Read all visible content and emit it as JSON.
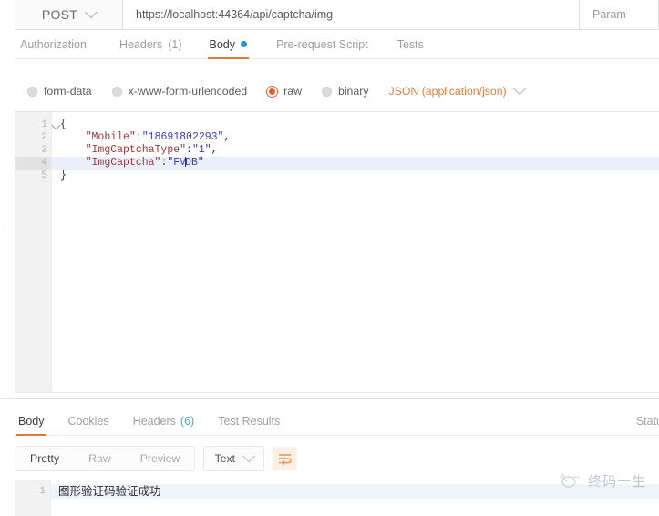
{
  "request": {
    "method": "POST",
    "url": "https://localhost:44364/api/captcha/img",
    "params_label": "Param",
    "tabs": [
      {
        "label": "Authorization",
        "count": "",
        "dot": false,
        "active": false
      },
      {
        "label": "Headers",
        "count": "(1)",
        "dot": false,
        "active": false
      },
      {
        "label": "Body",
        "count": "",
        "dot": true,
        "active": true
      },
      {
        "label": "Pre-request Script",
        "count": "",
        "dot": false,
        "active": false
      },
      {
        "label": "Tests",
        "count": "",
        "dot": false,
        "active": false
      }
    ],
    "body_types": [
      {
        "label": "form-data",
        "selected": false
      },
      {
        "label": "x-www-form-urlencoded",
        "selected": false
      },
      {
        "label": "raw",
        "selected": true
      },
      {
        "label": "binary",
        "selected": false
      }
    ],
    "content_type": "JSON (application/json)",
    "editor": {
      "lines": [
        {
          "number": "1",
          "fold": true,
          "highlight": false,
          "segments": [
            {
              "t": "{",
              "c": "p"
            }
          ]
        },
        {
          "number": "2",
          "fold": false,
          "highlight": false,
          "segments": [
            {
              "t": "    ",
              "c": "p"
            },
            {
              "t": "\"Mobile\"",
              "c": "k"
            },
            {
              "t": ":",
              "c": "p"
            },
            {
              "t": "\"18691802293\"",
              "c": "v"
            },
            {
              "t": ",",
              "c": "p"
            }
          ]
        },
        {
          "number": "3",
          "fold": false,
          "highlight": false,
          "segments": [
            {
              "t": "    ",
              "c": "p"
            },
            {
              "t": "\"ImgCaptchaType\"",
              "c": "k"
            },
            {
              "t": ":",
              "c": "p"
            },
            {
              "t": "\"1\"",
              "c": "v"
            },
            {
              "t": ",",
              "c": "p"
            }
          ]
        },
        {
          "number": "4",
          "fold": false,
          "highlight": true,
          "segments": [
            {
              "t": "    ",
              "c": "p"
            },
            {
              "t": "\"ImgCaptcha\"",
              "c": "k"
            },
            {
              "t": ":",
              "c": "p"
            },
            {
              "t": "\"FV",
              "c": "v"
            },
            {
              "t": "CARET",
              "c": "caret"
            },
            {
              "t": "DB\"",
              "c": "v"
            }
          ]
        },
        {
          "number": "5",
          "fold": false,
          "highlight": false,
          "segments": [
            {
              "t": "}",
              "c": "p"
            }
          ]
        }
      ]
    }
  },
  "response": {
    "tabs": [
      {
        "label": "Body",
        "count": "",
        "active": true
      },
      {
        "label": "Cookies",
        "count": "",
        "active": false
      },
      {
        "label": "Headers",
        "count": "(6)",
        "active": false
      },
      {
        "label": "Test Results",
        "count": "",
        "active": false
      }
    ],
    "status_label": "Statu",
    "view_modes": [
      {
        "label": "Pretty",
        "active": true
      },
      {
        "label": "Raw",
        "active": false
      },
      {
        "label": "Preview",
        "active": false
      }
    ],
    "format": "Text",
    "wrap_icon": "word-wrap-icon",
    "body_lines": [
      {
        "number": "1",
        "text": "图形验证码验证成功"
      }
    ]
  },
  "watermark": {
    "text": "终码一生",
    "icon": "brand-logo-icon"
  },
  "colors": {
    "accent_orange": "#e07a3b",
    "radio_orange": "#e2622a",
    "dot_blue": "#2d8fd5",
    "count_blue": "#4aa8dd",
    "json_key": "#9c3a38",
    "json_value": "#3f3fbf"
  }
}
